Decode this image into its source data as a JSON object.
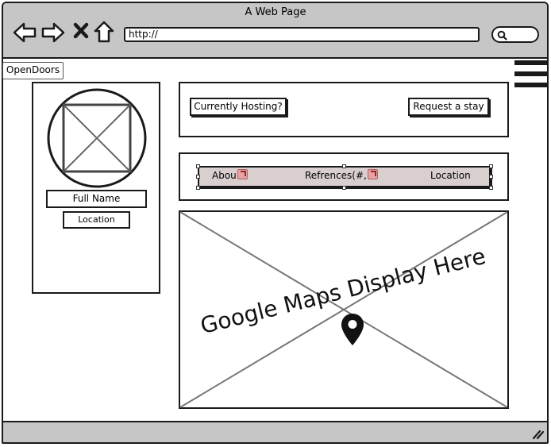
{
  "window": {
    "title": "A Web Page",
    "address": "http://",
    "nav_icons": [
      "back-arrow-icon",
      "forward-arrow-icon",
      "close-x-icon",
      "home-icon"
    ],
    "search_icon": "search-icon"
  },
  "header": {
    "logo_label": "OpenDoors",
    "menu_icon": "hamburger-menu-icon"
  },
  "profile": {
    "avatar": "image-placeholder",
    "full_name": "Full Name",
    "location": "Location"
  },
  "hosting": {
    "currently_hosting_label": "Currently Hosting?",
    "request_stay_label": "Request a stay"
  },
  "tabs": [
    {
      "label": "Abou",
      "link_icon": true
    },
    {
      "label": "Refrences(#,",
      "link_icon": true
    },
    {
      "label": "Location",
      "link_icon": false
    }
  ],
  "map": {
    "label": "Google Maps Display Here",
    "icon": "map-pin-icon"
  },
  "colors": {
    "chrome": "#c6c6c6",
    "tab_bar": "#d9cfcf",
    "stroke": "#1a1a1a"
  }
}
